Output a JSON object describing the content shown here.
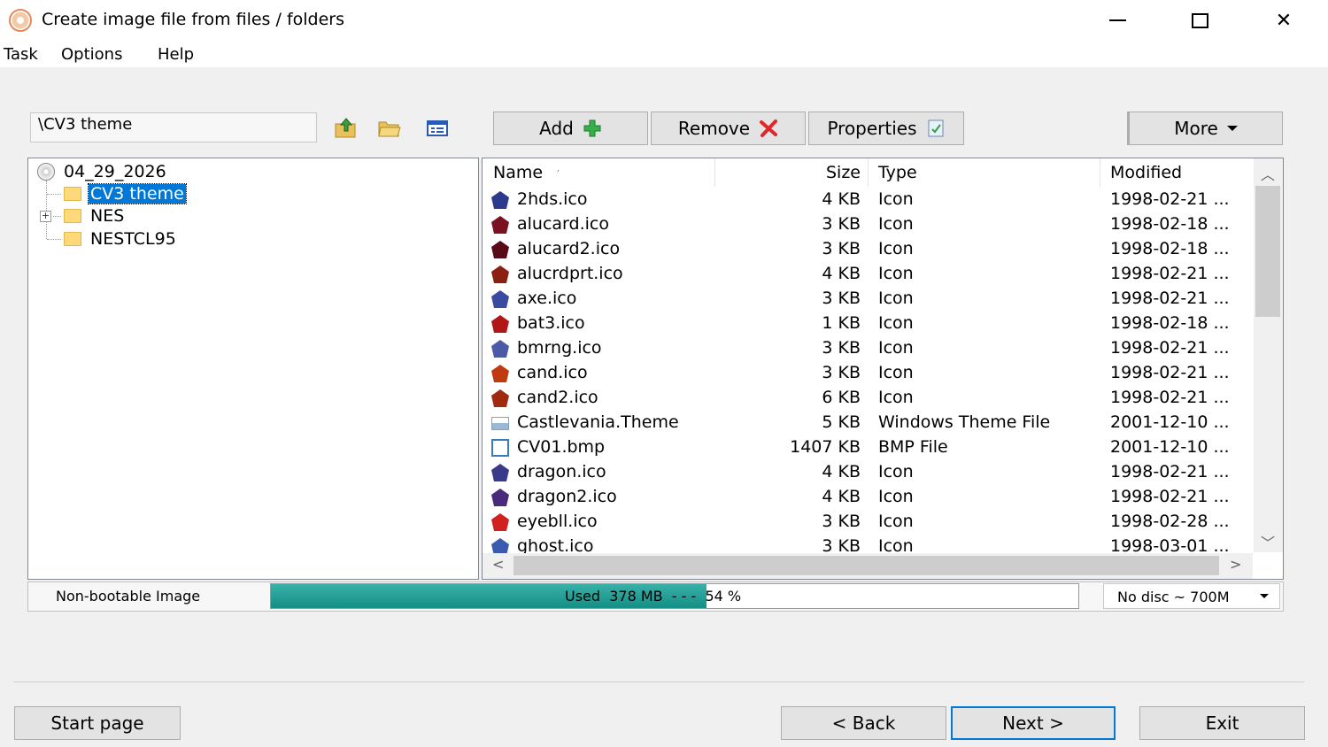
{
  "window": {
    "title": "Create image file from files / folders"
  },
  "menu": {
    "items": [
      "Task",
      "Options",
      "Help"
    ]
  },
  "path": {
    "value": "\\CV3 theme"
  },
  "toolbar": {
    "add": "Add",
    "remove": "Remove",
    "properties": "Properties",
    "more": "More"
  },
  "tree": {
    "root": "04_29_2026",
    "children": [
      {
        "label": "CV3 theme",
        "selected": true
      },
      {
        "label": "NES",
        "expandable": true
      },
      {
        "label": "NESTCL95"
      }
    ]
  },
  "filelist": {
    "columns": {
      "name": "Name",
      "size": "Size",
      "type": "Type",
      "modified": "Modified"
    },
    "sort_indicator": "′",
    "rows": [
      {
        "name": "2hds.ico",
        "size": "4 KB",
        "type": "Icon",
        "modified": "1998-02-21 ...",
        "icon": "icon-file-icon",
        "color": "#2b3a8c"
      },
      {
        "name": "alucard.ico",
        "size": "3 KB",
        "type": "Icon",
        "modified": "1998-02-18 ...",
        "icon": "icon-file-icon",
        "color": "#7a1020"
      },
      {
        "name": "alucard2.ico",
        "size": "3 KB",
        "type": "Icon",
        "modified": "1998-02-18 ...",
        "icon": "icon-file-icon",
        "color": "#5a0a16"
      },
      {
        "name": "alucrdprt.ico",
        "size": "4 KB",
        "type": "Icon",
        "modified": "1998-02-21 ...",
        "icon": "icon-file-icon",
        "color": "#8a2010"
      },
      {
        "name": "axe.ico",
        "size": "3 KB",
        "type": "Icon",
        "modified": "1998-02-21 ...",
        "icon": "icon-file-icon",
        "color": "#3a4aa0"
      },
      {
        "name": "bat3.ico",
        "size": "1 KB",
        "type": "Icon",
        "modified": "1998-02-18 ...",
        "icon": "icon-file-icon",
        "color": "#b01818"
      },
      {
        "name": "bmrng.ico",
        "size": "3 KB",
        "type": "Icon",
        "modified": "1998-02-21 ...",
        "icon": "icon-file-icon",
        "color": "#4a5aa8"
      },
      {
        "name": "cand.ico",
        "size": "3 KB",
        "type": "Icon",
        "modified": "1998-02-21 ...",
        "icon": "icon-file-icon",
        "color": "#c03a10"
      },
      {
        "name": "cand2.ico",
        "size": "6 KB",
        "type": "Icon",
        "modified": "1998-02-21 ...",
        "icon": "icon-file-icon",
        "color": "#a02a10"
      },
      {
        "name": "Castlevania.Theme",
        "size": "5 KB",
        "type": "Windows Theme File",
        "modified": "2001-12-10 ...",
        "icon": "theme-file-icon",
        "color": "#9ab8d8"
      },
      {
        "name": "CV01.bmp",
        "size": "1407 KB",
        "type": "BMP File",
        "modified": "2001-12-10 ...",
        "icon": "bmp-file-icon",
        "color": "#3a7ac0"
      },
      {
        "name": "dragon.ico",
        "size": "4 KB",
        "type": "Icon",
        "modified": "1998-02-21 ...",
        "icon": "icon-file-icon",
        "color": "#3a3a8a"
      },
      {
        "name": "dragon2.ico",
        "size": "4 KB",
        "type": "Icon",
        "modified": "1998-02-21 ...",
        "icon": "icon-file-icon",
        "color": "#4a2a7a"
      },
      {
        "name": "eyebll.ico",
        "size": "3 KB",
        "type": "Icon",
        "modified": "1998-02-28 ...",
        "icon": "icon-file-icon",
        "color": "#d02020"
      },
      {
        "name": "ghost.ico",
        "size": "3 KB",
        "type": "Icon",
        "modified": "1998-03-01 ...",
        "icon": "icon-file-icon",
        "color": "#3a5ab0"
      }
    ]
  },
  "status": {
    "boot": "Non-bootable Image",
    "usage_text": "Used  378 MB  - - -  54 %",
    "usage_percent": 54,
    "disc": "No disc ~ 700M"
  },
  "footer": {
    "start": "Start page",
    "back": "< Back",
    "next": "Next >",
    "exit": "Exit"
  },
  "colors": {
    "accent": "#0078d7",
    "usage": "#138f86"
  }
}
